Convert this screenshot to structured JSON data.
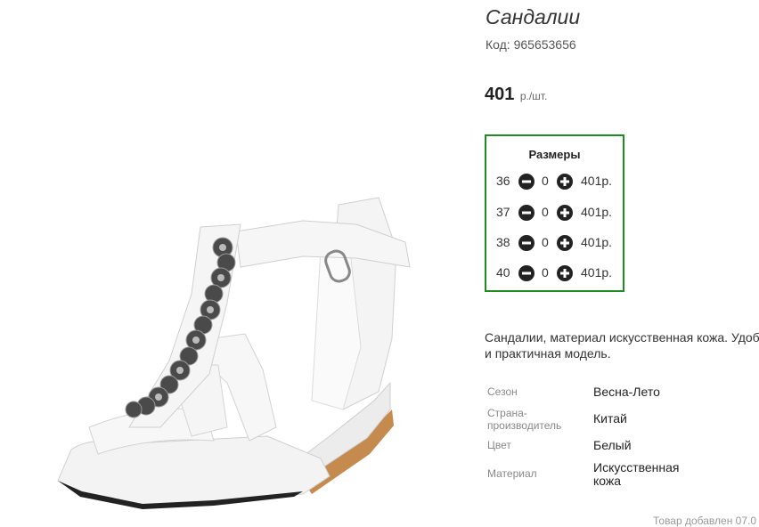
{
  "product": {
    "title": "Сандалии",
    "code": "Код: 965653656",
    "price_value": "401",
    "price_unit": "р./шт."
  },
  "sizes": {
    "title": "Размеры",
    "rows": [
      {
        "size": "36",
        "qty": "0",
        "price": "401р."
      },
      {
        "size": "37",
        "qty": "0",
        "price": "401р."
      },
      {
        "size": "38",
        "qty": "0",
        "price": "401р."
      },
      {
        "size": "40",
        "qty": "0",
        "price": "401р."
      }
    ]
  },
  "description": {
    "line1": "Сандалии, материал искусственная кожа. Удоб",
    "line2": "и практичная модель."
  },
  "attributes": [
    {
      "label": "Сезон",
      "value": "Весна-Лето"
    },
    {
      "label": "Страна-производитель",
      "value": "Китай"
    },
    {
      "label": "Цвет",
      "value": "Белый"
    },
    {
      "label": "Материал",
      "value": "Искусственная кожа"
    }
  ],
  "footer_note": "Товар добавлен 07.0",
  "colors": {
    "sizes_border": "#1e8c1e",
    "button_fill": "#222222"
  },
  "icons": {
    "decrease": "minus-circle-icon",
    "increase": "plus-circle-icon"
  }
}
